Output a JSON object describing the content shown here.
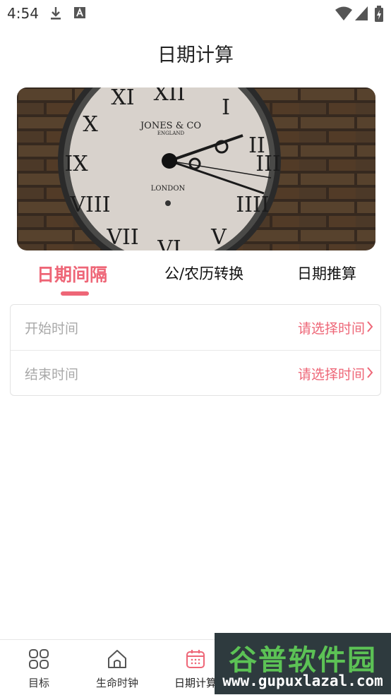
{
  "status_bar": {
    "time": "4:54",
    "icons": [
      "download-icon",
      "text-a-icon",
      "wifi-icon",
      "signal-icon",
      "battery-icon"
    ]
  },
  "header": {
    "title": "日期计算"
  },
  "banner": {
    "clock_brand": "JONES & CO",
    "clock_country": "ENGLAND",
    "clock_city": "LONDON"
  },
  "tabs": [
    {
      "label": "日期间隔",
      "active": true
    },
    {
      "label": "公/农历转换",
      "active": false
    },
    {
      "label": "日期推算",
      "active": false
    }
  ],
  "form": {
    "rows": [
      {
        "label": "开始时间",
        "action": "请选择时间"
      },
      {
        "label": "结束时间",
        "action": "请选择时间"
      }
    ]
  },
  "bottom_nav": {
    "items": [
      {
        "label": "目标",
        "icon": "grid-icon"
      },
      {
        "label": "生命时钟",
        "icon": "home-icon"
      },
      {
        "label": "日期计算",
        "icon": "calendar-icon",
        "active": true
      }
    ]
  },
  "watermark": {
    "title": "谷普软件园",
    "url": "www.gupuxlazal.com"
  },
  "colors": {
    "accent": "#ee6677",
    "placeholder": "#a8a8a8",
    "text": "#222222"
  }
}
